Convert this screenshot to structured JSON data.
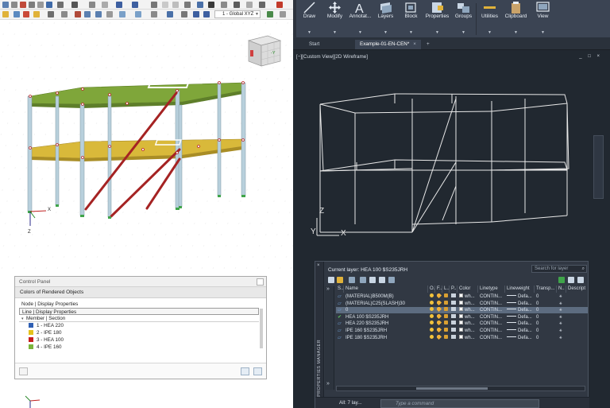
{
  "left_app": {
    "coord_system": "1 - Global XYZ",
    "axis_labels": {
      "x": "X",
      "z": "Z"
    },
    "nav_cube_label": "-Y",
    "control_panel": {
      "title": "Control Panel",
      "header": "Colors of Rendered Objects",
      "rows": [
        "Node | Display Properties",
        "Line | Display Properties",
        "Member | Section"
      ],
      "sections": [
        {
          "label": "1 - HEA 220",
          "color": "#2f5fb3"
        },
        {
          "label": "2 - IPE 180",
          "color": "#e4c21b"
        },
        {
          "label": "3 - HEA 100",
          "color": "#c81d1d"
        },
        {
          "label": "4 - IPE 160",
          "color": "#7bb43b"
        }
      ]
    }
  },
  "ribbon": {
    "buttons": [
      {
        "label": "Draw",
        "icon": "draw-icon"
      },
      {
        "label": "Modify",
        "icon": "modify-icon"
      },
      {
        "label": "Annotat...",
        "icon": "annotation-icon"
      },
      {
        "label": "Layers",
        "icon": "layers-icon"
      },
      {
        "label": "Block",
        "icon": "block-icon"
      },
      {
        "label": "Properties",
        "icon": "properties-icon"
      },
      {
        "label": "Groups",
        "icon": "groups-icon"
      },
      {
        "label": "Utilities",
        "icon": "utilities-icon"
      },
      {
        "label": "Clipboard",
        "icon": "clipboard-icon"
      },
      {
        "label": "View",
        "icon": "view-icon"
      }
    ]
  },
  "doc_tabs": {
    "start": "Start",
    "active": "Example-01-EN-CEN*",
    "add": "+"
  },
  "viewport": {
    "label": "[−][Custom View][2D Wireframe]",
    "controls": "_ □ ×",
    "ucs": {
      "z": "Z",
      "y": "Y",
      "x": "X"
    }
  },
  "layer_manager": {
    "side_title": "LAYER PROPERTIES MANAGER",
    "current_layer": "Current layer: HEA 100 $S235JRH",
    "search_placeholder": "Search for layer",
    "columns": [
      "S..",
      "Name",
      "O..",
      "F..",
      "L..",
      "P..",
      "Color",
      "Linetype",
      "Lineweight",
      "Transp...",
      "N..",
      "Descript"
    ],
    "layers": [
      {
        "name": "(MATERIAL)B500M(B)",
        "color": "wh...",
        "linetype": "CONTIN...",
        "lineweight": "Defa...",
        "transparency": "0",
        "selected": false
      },
      {
        "name": "(MATERIAL)C25(SLASH)30",
        "color": "wh...",
        "linetype": "CONTIN...",
        "lineweight": "Defa...",
        "transparency": "0",
        "selected": false
      },
      {
        "name": "0",
        "color": "wh...",
        "linetype": "CONTIN...",
        "lineweight": "Defa...",
        "transparency": "0",
        "selected": true
      },
      {
        "name": "HEA 100 $S235JRH",
        "color": "wh...",
        "linetype": "CONTIN...",
        "lineweight": "Defa...",
        "transparency": "0",
        "selected": false,
        "current": true
      },
      {
        "name": "HEA 220 $S235JRH",
        "color": "wh...",
        "linetype": "CONTIN...",
        "lineweight": "Defa...",
        "transparency": "0",
        "selected": false
      },
      {
        "name": "IPE 160 $S235JRH",
        "color": "wh...",
        "linetype": "CONTIN...",
        "lineweight": "Defa...",
        "transparency": "0",
        "selected": false
      },
      {
        "name": "IPE 180 $S235JRH",
        "color": "wh...",
        "linetype": "CONTIN...",
        "lineweight": "Defa...",
        "transparency": "0",
        "selected": false
      }
    ],
    "status": "All: 7 lay...",
    "command_placeholder": "Type a command"
  }
}
